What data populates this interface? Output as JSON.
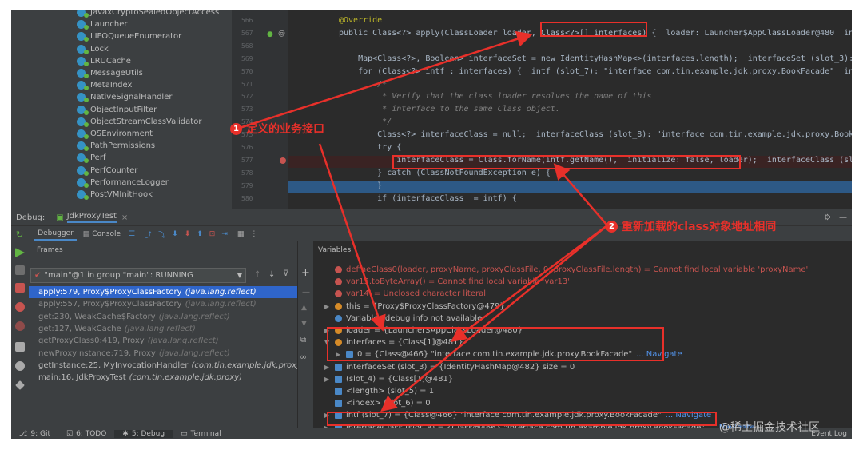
{
  "tree": {
    "items": [
      "JavaxCryptoSealedObjectAccess",
      "Launcher",
      "LIFOQueueEnumerator",
      "Lock",
      "LRUCache",
      "MessageUtils",
      "MetaIndex",
      "NativeSignalHandler",
      "ObjectInputFilter",
      "ObjectStreamClassValidator",
      "OSEnvironment",
      "PathPermissions",
      "Perf",
      "PerfCounter",
      "PerformanceLogger",
      "PostVMInitHook"
    ]
  },
  "editor": {
    "line_numbers": [
      "566",
      "567",
      "568",
      "569",
      "570",
      "571",
      "572",
      "573",
      "574",
      "575",
      "576",
      "577",
      "578",
      "579",
      "580"
    ],
    "lines": [
      {
        "t": "@Override",
        "c": "ann"
      },
      {
        "t": "public Class<?> apply(ClassLoader loader, Class<?>[] interfaces) {  loader: Launcher$AppClassLoader@480  inte"
      },
      {
        "t": ""
      },
      {
        "t": "    Map<Class<?>, Boolean> interfaceSet = new IdentityHashMap<>(interfaces.length);  interfaceSet (slot_3):"
      },
      {
        "t": "    for (Class<?> intf : interfaces) {  intf (slot_7): \"interface com.tin.example.jdk.proxy.BookFacade\"  inte"
      },
      {
        "t": "        /*",
        "c": "cmt"
      },
      {
        "t": "         * Verify that the class loader resolves the name of this",
        "c": "cmt"
      },
      {
        "t": "         * interface to the same Class object.",
        "c": "cmt"
      },
      {
        "t": "         */",
        "c": "cmt"
      },
      {
        "t": "        Class<?> interfaceClass = null;  interfaceClass (slot_8): \"interface com.tin.example.jdk.proxy.BookF"
      },
      {
        "t": "        try {"
      },
      {
        "t": "            interfaceClass = Class.forName(intf.getName(),  initialize: false, loader);  interfaceClass (slot_8):"
      },
      {
        "t": "        } catch (ClassNotFoundException e) {"
      },
      {
        "t": "        }"
      },
      {
        "t": "        if (interfaceClass != intf) {"
      }
    ]
  },
  "debug": {
    "label": "Debug:",
    "tab": "JdkProxyTest",
    "debugger_tab": "Debugger",
    "console_tab": "Console"
  },
  "frames": {
    "header": "Frames",
    "thread": "\"main\"@1 in group \"main\": RUNNING",
    "items": [
      {
        "m": "apply:579, Proxy$ProxyClassFactory",
        "p": "(java.lang.reflect)",
        "state": "sel"
      },
      {
        "m": "apply:557, Proxy$ProxyClassFactory",
        "p": "(java.lang.reflect)",
        "state": "lib"
      },
      {
        "m": "get:230, WeakCache$Factory",
        "p": "(java.lang.reflect)",
        "state": "lib"
      },
      {
        "m": "get:127, WeakCache",
        "p": "(java.lang.reflect)",
        "state": "lib"
      },
      {
        "m": "getProxyClass0:419, Proxy",
        "p": "(java.lang.reflect)",
        "state": "lib"
      },
      {
        "m": "newProxyInstance:719, Proxy",
        "p": "(java.lang.reflect)",
        "state": "lib"
      },
      {
        "m": "getInstance:25, MyInvocationHandler",
        "p": "(com.tin.example.jdk.proxy)",
        "state": "app"
      },
      {
        "m": "main:16, JdkProxyTest",
        "p": "(com.tin.example.jdk.proxy)",
        "state": "app"
      }
    ]
  },
  "variables": {
    "header": "Variables",
    "items": [
      {
        "n": "defineClass0(loader, proxyName, proxyClassFile, 0, proxyClassFile.length) = Cannot find local variable 'proxyName'",
        "icon": "red"
      },
      {
        "n": "var13.toByteArray() = Cannot find local variable 'var13'",
        "icon": "red"
      },
      {
        "n": "var14' = Unclosed character literal",
        "icon": "red"
      },
      {
        "n": "this = {Proxy$ProxyClassFactory@479}",
        "icon": "or",
        "tri": "▶"
      },
      {
        "n": "Variables debug info not available",
        "icon": "blue"
      },
      {
        "n": "loader = {Launcher$AppClassLoader@480}",
        "icon": "or",
        "tri": "▶"
      },
      {
        "n": "interfaces = {Class[1]@481}",
        "icon": "or",
        "tri": "▼"
      },
      {
        "n": "0 = {Class@466} \"interface com.tin.example.jdk.proxy.BookFacade\"",
        "nav": "... Navigate",
        "icon": "sq",
        "tri": "▶",
        "indent": 1
      },
      {
        "n": "interfaceSet (slot_3) = {IdentityHashMap@482}  size = 0",
        "icon": "sq",
        "tri": "▶"
      },
      {
        "n": "(slot_4) = {Class[1]@481}",
        "icon": "sq",
        "tri": "▶"
      },
      {
        "n": "<length> (slot_5) = 1",
        "icon": "sq"
      },
      {
        "n": "<index> (slot_6) = 0",
        "icon": "sq"
      },
      {
        "n": "intf (slot_7) = {Class@466} \"interface com.tin.example.jdk.proxy.BookFacade\"",
        "nav": "... Navigate",
        "icon": "sq",
        "tri": "▶"
      },
      {
        "n": "interfaceClass (slot_8) = {Class@466} \"interface com.tin.example.jdk.proxy.BookFacade\"",
        "nav": "... Navigate",
        "icon": "sq",
        "tri": "▶"
      }
    ]
  },
  "status": {
    "tabs": [
      "9: Git",
      "6: TODO",
      "5: Debug",
      "Terminal"
    ],
    "event_log": "Event Log"
  },
  "annotations": {
    "one_num": "1",
    "one": "定义的业务接口",
    "two_num": "2",
    "two": "重新加载的class对象地址相同"
  },
  "watermark": "@稀土掘金技术社区"
}
